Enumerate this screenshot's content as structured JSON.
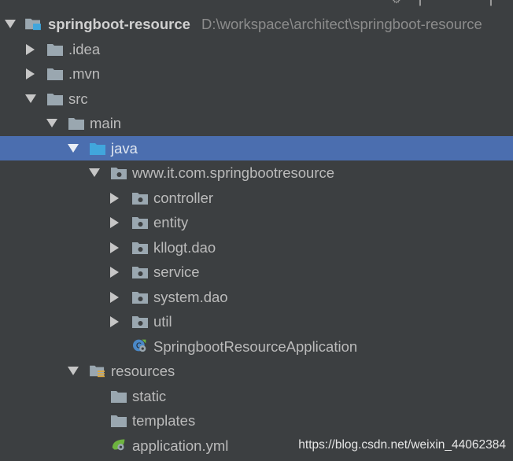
{
  "project": {
    "name": "springboot-resource",
    "path": "D:\\workspace\\architect\\springboot-resource"
  },
  "tree": {
    "idea": ".idea",
    "mvn": ".mvn",
    "src": "src",
    "main": "main",
    "java": "java",
    "package": "www.it.com.springbootresource",
    "controller": "controller",
    "entity": "entity",
    "kllogt": "kllogt.dao",
    "service": "service",
    "system": "system.dao",
    "util": "util",
    "app_class": "SpringbootResourceApplication",
    "resources": "resources",
    "static": "static",
    "templates": "templates",
    "app_yml": "application.yml"
  },
  "watermark": "https://blog.csdn.net/weixin_44062384",
  "colors": {
    "background": "#3c3f41",
    "selection": "#4b6eaf",
    "folder": "#9aa7b0",
    "source_folder": "#41a6dc",
    "spring_green": "#6db33f"
  }
}
